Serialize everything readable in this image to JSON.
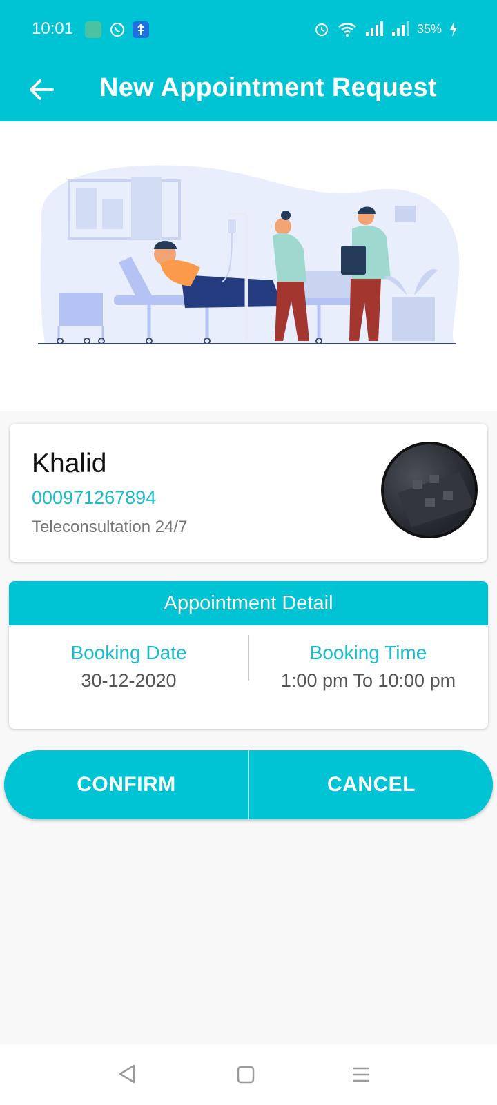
{
  "status_bar": {
    "time": "10:01",
    "battery_text": "35%",
    "icons": [
      "notification-app-icon",
      "whatsapp-icon",
      "usb-icon",
      "alarm-icon",
      "wifi-icon",
      "signal-icon",
      "signal-icon-2",
      "charging-icon"
    ]
  },
  "app_bar": {
    "title": "New Appointment Request",
    "back_icon": "arrow-left-icon"
  },
  "hero": {
    "illustration": "hospital-room-illustration"
  },
  "patient": {
    "name": "Khalid",
    "phone": "000971267894",
    "service": "Teleconsultation 24/7"
  },
  "appointment": {
    "header": "Appointment Detail",
    "date_label": "Booking Date",
    "date_value": "30-12-2020",
    "time_label": "Booking Time",
    "time_value": "1:00 pm To 10:00 pm"
  },
  "actions": {
    "confirm": "CONFIRM",
    "cancel": "CANCEL"
  },
  "nav": {
    "icons": [
      "back-triangle-icon",
      "home-square-icon",
      "menu-lines-icon"
    ]
  },
  "colors": {
    "accent": "#00c3d3",
    "accent_text": "#19bccc"
  }
}
